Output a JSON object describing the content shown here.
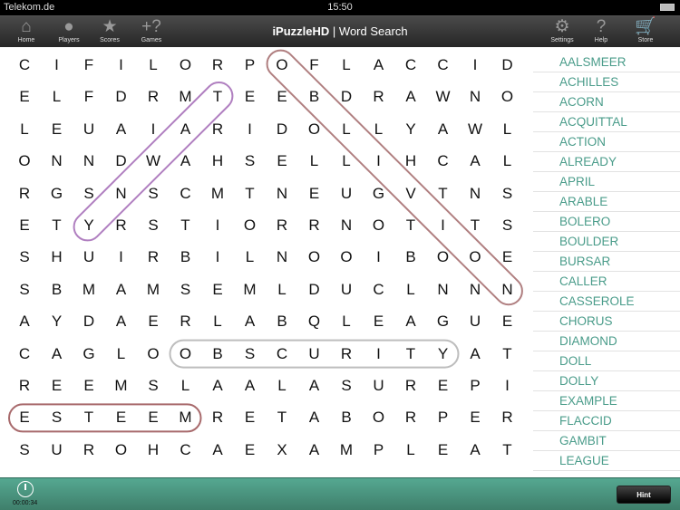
{
  "status": {
    "carrier": "Telekom.de",
    "time": "15:50"
  },
  "toolbar": {
    "left": [
      {
        "label": "Home",
        "icon": "home-icon",
        "glyph": "⌂"
      },
      {
        "label": "Players",
        "icon": "person-icon",
        "glyph": "●"
      },
      {
        "label": "Scores",
        "icon": "star-icon",
        "glyph": "★"
      },
      {
        "label": "Games",
        "icon": "plus-question-icon",
        "glyph": "+?"
      }
    ],
    "right": [
      {
        "label": "Settings",
        "icon": "gear-icon",
        "glyph": "⚙"
      },
      {
        "label": "Help",
        "icon": "question-icon",
        "glyph": "?"
      },
      {
        "label": "Store",
        "icon": "cart-icon",
        "glyph": "🛒"
      }
    ],
    "app_name": "iPuzzleHD",
    "separator": "|",
    "title": "Word Search"
  },
  "grid": [
    "CIFILORPOFLACCID",
    "ELFDRMTEEBDRAWNO",
    "LEUAIARIDOLLYAWL",
    "ONNDWAHSELLIHCAL",
    "RGSNSCMTNEUGVTNS",
    "ETYRSTIORRNOTITS",
    "SHUIRBILNOOIBOOE",
    "SBMAMSEMLDUCLNNN",
    "AYDAERLABQLEAGUE",
    "CAGLOOBSCURITYAT",
    "REEMSLAALASUREPI",
    "ESTEEMRETABORPER",
    "SUROHCAEXAMPLEAT"
  ],
  "found": [
    {
      "from": [
        0,
        8
      ],
      "to": [
        7,
        15
      ],
      "color": "#b07f80"
    },
    {
      "from": [
        1,
        6
      ],
      "to": [
        5,
        2
      ],
      "color": "#b07fc0"
    },
    {
      "from": [
        9,
        5
      ],
      "to": [
        9,
        13
      ],
      "color": "#bdbdbd"
    },
    {
      "from": [
        11,
        0
      ],
      "to": [
        11,
        5
      ],
      "color": "#a86a6c"
    }
  ],
  "words": [
    "AALSMEER",
    "ACHILLES",
    "ACORN",
    "ACQUITTAL",
    "ACTION",
    "ALREADY",
    "APRIL",
    "ARABLE",
    "BOLERO",
    "BOULDER",
    "BURSAR",
    "CALLER",
    "CASSEROLE",
    "CHORUS",
    "DIAMOND",
    "DOLL",
    "DOLLY",
    "EXAMPLE",
    "FLACCID",
    "GAMBIT",
    "LEAGUE"
  ],
  "colors": {
    "word_list": "#4a9c8a",
    "bottom_bar": "#4a947e"
  },
  "bottom": {
    "timer": "00:00:34",
    "hint": "Hint"
  }
}
